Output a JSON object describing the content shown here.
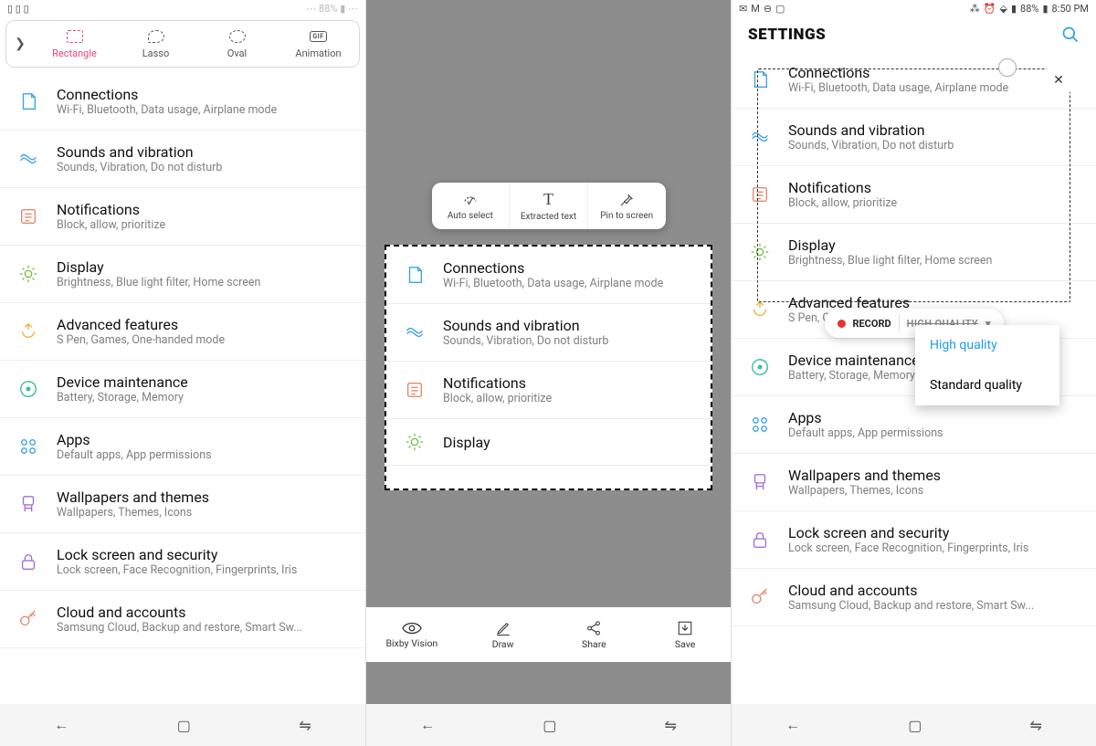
{
  "statusbar": {
    "battery": "88%",
    "time": "8:50 PM"
  },
  "pen_tools": {
    "items": [
      {
        "label": "Rectangle",
        "active": true
      },
      {
        "label": "Lasso"
      },
      {
        "label": "Oval"
      },
      {
        "label": "Animation"
      }
    ]
  },
  "settings_title": "SETTINGS",
  "settings": [
    {
      "title": "Connections",
      "sub": "Wi-Fi, Bluetooth, Data usage, Airplane mode",
      "color": "#3fa3e0"
    },
    {
      "title": "Sounds and vibration",
      "sub": "Sounds, Vibration, Do not disturb",
      "color": "#3fa3e0"
    },
    {
      "title": "Notifications",
      "sub": "Block, allow, prioritize",
      "color": "#e28a6f"
    },
    {
      "title": "Display",
      "sub": "Brightness, Blue light filter, Home screen",
      "color": "#7cc04d"
    },
    {
      "title": "Advanced features",
      "sub": "S Pen, Games, One-handed mode",
      "color": "#eab53e"
    },
    {
      "title": "Device maintenance",
      "sub": "Battery, Storage, Memory",
      "color": "#3fbf9f"
    },
    {
      "title": "Apps",
      "sub": "Default apps, App permissions",
      "color": "#3fa3e0"
    },
    {
      "title": "Wallpapers and themes",
      "sub": "Wallpapers, Themes, Icons",
      "color": "#a36fd6"
    },
    {
      "title": "Lock screen and security",
      "sub": "Lock screen, Face Recognition, Fingerprints, Iris",
      "color": "#a36fd6"
    },
    {
      "title": "Cloud and accounts",
      "sub": "Samsung Cloud, Backup and restore, Smart Sw...",
      "color": "#e28a6f"
    }
  ],
  "phone2_float_tools": [
    {
      "label": "Auto select"
    },
    {
      "label": "Extracted text"
    },
    {
      "label": "Pin to screen"
    }
  ],
  "phone2_bottom_tools": [
    {
      "label": "Bixby Vision"
    },
    {
      "label": "Draw"
    },
    {
      "label": "Share"
    },
    {
      "label": "Save"
    }
  ],
  "phone3_record": {
    "label": "RECORD",
    "quality_label_struck": "HIGH QUALITY"
  },
  "phone3_quality_menu": [
    {
      "label": "High quality",
      "selected": true
    },
    {
      "label": "Standard quality",
      "selected": false
    }
  ]
}
